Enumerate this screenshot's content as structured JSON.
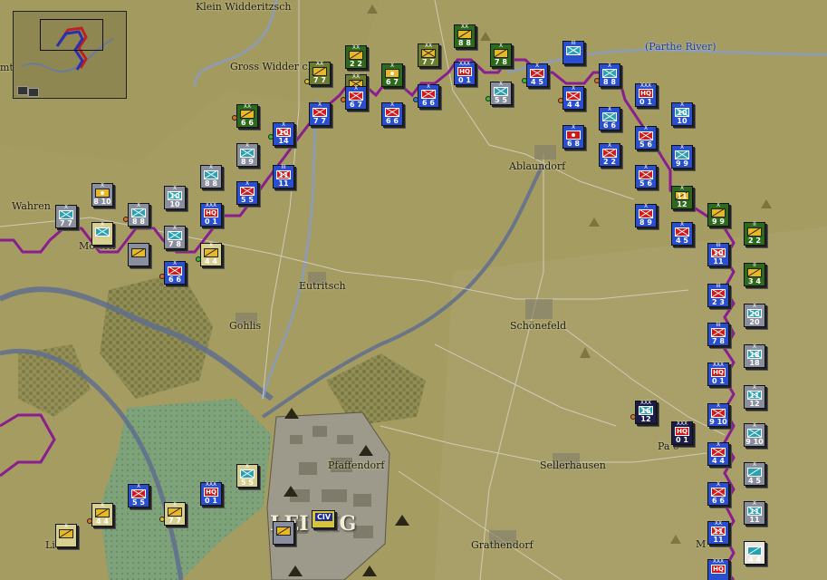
{
  "towns": [
    {
      "id": "klein-widderitzsch",
      "label": "Klein Widderitzsch"
    },
    {
      "id": "gross-widderitzsch",
      "label": "Gross Widder  ch"
    },
    {
      "id": "wahren",
      "label": "Wahren"
    },
    {
      "id": "mockern",
      "label": "Mo   ern"
    },
    {
      "id": "eutritsch",
      "label": "Eutritsch"
    },
    {
      "id": "gohlis",
      "label": "Gohlis"
    },
    {
      "id": "ablaundorf",
      "label": "Ablaundorf"
    },
    {
      "id": "schonefeld",
      "label": "Schönefeld"
    },
    {
      "id": "pfaffendorf",
      "label": "Pfaffendorf"
    },
    {
      "id": "sellerhausen",
      "label": "Sellerhausen"
    },
    {
      "id": "grathendorf",
      "label": "Grathendorf"
    },
    {
      "id": "leipzig",
      "label": "LEI  ZIG"
    },
    {
      "id": "lindenau",
      "label": "Li      au"
    },
    {
      "id": "paunsdorf",
      "label": "Pa       o"
    },
    {
      "id": "mockau",
      "label": "M        a"
    },
    {
      "id": "edge-town",
      "label": "mt"
    }
  ],
  "river_label": "(Parthe River)",
  "units": [
    {
      "id": "u1",
      "side": "french",
      "color": "#6a7c2e",
      "type": "yellow-cav",
      "size": "XX",
      "str": "7 7"
    },
    {
      "id": "u2",
      "side": "french",
      "color": "#2e6a1c",
      "type": "yellow-cav",
      "size": "XX",
      "str": "2 2"
    },
    {
      "id": "u3",
      "side": "french",
      "color": "#2e6a1c",
      "type": "yellow-cav",
      "size": "XX",
      "str": "8 8"
    },
    {
      "id": "u4",
      "side": "french",
      "color": "#6a7c2e",
      "type": "yellow-inf",
      "size": "XX",
      "str": "7 7"
    },
    {
      "id": "u5",
      "side": "french",
      "color": "#2e6a1c",
      "type": "art",
      "size": "X",
      "str": "6 7"
    },
    {
      "id": "u6",
      "side": "french",
      "color": "#2e6a1c",
      "type": "yellow-cav",
      "size": "X",
      "str": "7 8"
    },
    {
      "id": "u7",
      "side": "french",
      "color": "#6a7c2e",
      "type": "yellow-inf",
      "size": "XX",
      "str": "3 3"
    },
    {
      "id": "u8",
      "side": "french",
      "color": "#2e6a1c",
      "type": "yellow-cav",
      "size": "XX",
      "str": "6 6"
    },
    {
      "id": "u9",
      "side": "allied",
      "color": "#2a4ed0",
      "type": "red-inf",
      "size": "X",
      "str": "6 7"
    },
    {
      "id": "u10",
      "side": "allied",
      "color": "#2a4ed0",
      "type": "red-inf",
      "size": "X",
      "str": "7 7"
    },
    {
      "id": "u11",
      "side": "allied",
      "color": "#2a4ed0",
      "type": "red-inf",
      "size": "X",
      "str": "6 6"
    },
    {
      "id": "u12",
      "side": "allied",
      "color": "#2a4ed0",
      "type": "red-inf",
      "size": "X",
      "str": "6 6"
    },
    {
      "id": "u13",
      "side": "allied",
      "color": "#2a4ed0",
      "type": "hq",
      "size": "XXX",
      "str": "0 1"
    },
    {
      "id": "u14",
      "side": "allied",
      "color": "#8a8fa0",
      "type": "teal-inf",
      "size": "X",
      "str": "5 5"
    },
    {
      "id": "u15",
      "side": "allied",
      "color": "#2a4ed0",
      "type": "red-inf",
      "size": "X",
      "str": "4 5"
    },
    {
      "id": "u16",
      "side": "allied",
      "color": "#2a4ed0",
      "type": "teal-inf",
      "size": "III",
      "str": ""
    },
    {
      "id": "u17",
      "side": "allied",
      "color": "#2a4ed0",
      "type": "teal-inf",
      "size": "X",
      "str": "8 8"
    },
    {
      "id": "u18",
      "side": "allied",
      "color": "#2a4ed0",
      "type": "hq",
      "size": "XXX",
      "str": "0 1"
    },
    {
      "id": "u19",
      "side": "allied",
      "color": "#2a4ed0",
      "type": "red-inf",
      "size": "X",
      "str": "4 4"
    },
    {
      "id": "u20",
      "side": "allied",
      "color": "#2a4ed0",
      "type": "teal-inf",
      "size": "X",
      "str": "10 10"
    },
    {
      "id": "u21",
      "side": "allied",
      "color": "#2a4ed0",
      "type": "teal-inf",
      "size": "X",
      "str": "6 6"
    },
    {
      "id": "u22",
      "side": "allied",
      "color": "#2a4ed0",
      "type": "red-art",
      "size": "X",
      "str": "6 8"
    },
    {
      "id": "u23",
      "side": "allied",
      "color": "#2a4ed0",
      "type": "red-inf",
      "size": "X",
      "str": "5 6"
    },
    {
      "id": "u24",
      "side": "allied",
      "color": "#2a4ed0",
      "type": "teal-inf",
      "size": "X",
      "str": "9 9"
    },
    {
      "id": "u25",
      "side": "allied",
      "color": "#2a4ed0",
      "type": "red-inf",
      "size": "X",
      "str": "2 2"
    },
    {
      "id": "u26",
      "side": "allied",
      "color": "#2a4ed0",
      "type": "red-inf",
      "size": "X",
      "str": "5 6"
    },
    {
      "id": "u27",
      "side": "french",
      "color": "#2e6a1c",
      "type": "yellow-cav",
      "size": "X",
      "str": "11 12"
    },
    {
      "id": "u28",
      "side": "allied",
      "color": "#2a4ed0",
      "type": "red-inf",
      "size": "X",
      "str": "8 9"
    },
    {
      "id": "u29",
      "side": "french",
      "color": "#2e6a1c",
      "type": "yellow-cav",
      "size": "X",
      "str": "9 9"
    },
    {
      "id": "u30",
      "side": "allied",
      "color": "#2a4ed0",
      "type": "red-inf",
      "size": "X",
      "str": "4 5"
    },
    {
      "id": "u31",
      "side": "french",
      "color": "#2e6a1c",
      "type": "yellow-cav",
      "size": "II",
      "str": "2 2"
    },
    {
      "id": "u32",
      "side": "allied",
      "color": "#2a4ed0",
      "type": "red-inf",
      "size": "III",
      "str": "10 11"
    },
    {
      "id": "u33",
      "side": "french",
      "color": "#2e6a1c",
      "type": "yellow-cav",
      "size": "II",
      "str": "3 4"
    },
    {
      "id": "u34",
      "side": "allied",
      "color": "#2a4ed0",
      "type": "red-inf",
      "size": "III",
      "str": "2 3"
    },
    {
      "id": "u35",
      "side": "allied",
      "color": "#8a8fa0",
      "type": "teal-inf",
      "size": "X",
      "str": "20 20"
    },
    {
      "id": "u36",
      "side": "allied",
      "color": "#2a4ed0",
      "type": "red-inf",
      "size": "III",
      "str": "7 8"
    },
    {
      "id": "u37",
      "side": "allied",
      "color": "#8a8fa0",
      "type": "teal-inf",
      "size": "X",
      "str": "18 18"
    },
    {
      "id": "u38",
      "side": "allied",
      "color": "#2a4ed0",
      "type": "hq",
      "size": "XXX",
      "str": "0 1"
    },
    {
      "id": "u39",
      "side": "allied",
      "color": "#8a8fa0",
      "type": "teal-inf",
      "size": "X",
      "str": "11 12"
    },
    {
      "id": "u40",
      "side": "allied",
      "color": "#2a4ed0",
      "type": "red-inf",
      "size": "X",
      "str": "9 10"
    },
    {
      "id": "u41",
      "side": "allied",
      "color": "#8a8fa0",
      "type": "teal-inf",
      "size": "X",
      "str": "9 10"
    },
    {
      "id": "u42",
      "side": "allied",
      "color": "#2a4ed0",
      "type": "red-inf",
      "size": "X",
      "str": "4 4"
    },
    {
      "id": "u43",
      "side": "allied",
      "color": "#8a8fa0",
      "type": "teal-cav",
      "size": "X",
      "str": "4 5"
    },
    {
      "id": "u44",
      "side": "allied",
      "color": "#2a4ed0",
      "type": "red-inf",
      "size": "X",
      "str": "6 6"
    },
    {
      "id": "u45",
      "side": "allied",
      "color": "#8a8fa0",
      "type": "teal-inf",
      "size": "X",
      "str": "11 11"
    },
    {
      "id": "u46",
      "side": "allied",
      "color": "#2a4ed0",
      "type": "red-inf",
      "size": "XX",
      "str": "11 11"
    },
    {
      "id": "u47",
      "side": "allied",
      "color": "#e8e8e0",
      "type": "teal-cav",
      "size": "",
      "str": "4 4"
    },
    {
      "id": "u48",
      "side": "allied",
      "color": "#2a4ed0",
      "type": "hq",
      "size": "XXX",
      "str": ""
    },
    {
      "id": "u49",
      "side": "allied",
      "color": "#2a4ed0",
      "type": "red-inf",
      "size": "X",
      "str": "10 14"
    },
    {
      "id": "u50",
      "side": "allied",
      "color": "#8a8fa0",
      "type": "teal-inf",
      "size": "X",
      "str": "8 9"
    },
    {
      "id": "u51",
      "side": "allied",
      "color": "#2a4ed0",
      "type": "red-inf",
      "size": "III",
      "str": "11 11"
    },
    {
      "id": "u52",
      "side": "allied",
      "color": "#8a8fa0",
      "type": "teal-inf",
      "size": "X",
      "str": "8 8"
    },
    {
      "id": "u53",
      "side": "allied",
      "color": "#2a4ed0",
      "type": "red-inf",
      "size": "X",
      "str": "5 5"
    },
    {
      "id": "u54",
      "side": "allied",
      "color": "#8a8fa0",
      "type": "teal-inf",
      "size": "X",
      "str": "10 10"
    },
    {
      "id": "u55",
      "side": "allied",
      "color": "#2a4ed0",
      "type": "hq",
      "size": "XXX",
      "str": "0 1"
    },
    {
      "id": "u56",
      "side": "allied",
      "color": "#8a8fa0",
      "type": "art",
      "size": "X",
      "str": "8 10"
    },
    {
      "id": "u57",
      "side": "allied",
      "color": "#8a8fa0",
      "type": "teal-inf",
      "size": "X",
      "str": "7 7"
    },
    {
      "id": "u58",
      "side": "allied",
      "color": "#8a8fa0",
      "type": "teal-inf",
      "size": "X",
      "str": "8 8"
    },
    {
      "id": "u59",
      "side": "allied",
      "color": "#8a8fa0",
      "type": "teal-inf",
      "size": "X",
      "str": "7 8"
    },
    {
      "id": "u60",
      "side": "allied",
      "color": "#d8d090",
      "type": "yellow-cav",
      "size": "X",
      "str": "4 4"
    },
    {
      "id": "u61",
      "side": "allied",
      "color": "#2a4ed0",
      "type": "red-inf",
      "size": "X",
      "str": "6 6"
    },
    {
      "id": "u62",
      "side": "allied",
      "color": "#d8d090",
      "type": "teal-inf",
      "size": "X",
      "str": ""
    },
    {
      "id": "u63",
      "side": "allied",
      "color": "#8a8fa0",
      "type": "yellow-cav",
      "size": "",
      "str": ""
    },
    {
      "id": "u64",
      "side": "allied",
      "color": "#2a4ed0",
      "type": "red-inf",
      "size": "X",
      "str": "5 5"
    },
    {
      "id": "u65",
      "side": "allied",
      "color": "#d8d090",
      "type": "yellow-cav",
      "size": "X",
      "str": "7 7"
    },
    {
      "id": "u66",
      "side": "allied",
      "color": "#2a4ed0",
      "type": "hq",
      "size": "XXX",
      "str": "0 1"
    },
    {
      "id": "u67",
      "side": "allied",
      "color": "#d8d090",
      "type": "teal-inf",
      "size": "X",
      "str": "5 5"
    },
    {
      "id": "u68",
      "side": "allied",
      "color": "#d8d090",
      "type": "yellow-cav",
      "size": "X",
      "str": "4 4"
    },
    {
      "id": "u69",
      "side": "allied",
      "color": "#8a8fa0",
      "type": "yellow-cav",
      "size": "",
      "str": ""
    },
    {
      "id": "u70",
      "side": "allied",
      "color": "#d8d090",
      "type": "yellow-cav",
      "size": "X",
      "str": ""
    },
    {
      "id": "u71",
      "side": "french",
      "color": "#1c1c4a",
      "type": "teal-inf",
      "size": "XXX",
      "str": "16 12"
    },
    {
      "id": "u72",
      "side": "french",
      "color": "#1c1c4a",
      "type": "hq",
      "size": "XXX",
      "str": "0 1"
    }
  ],
  "civ_marker": "CIV",
  "minimap": {
    "label": "overview map"
  }
}
